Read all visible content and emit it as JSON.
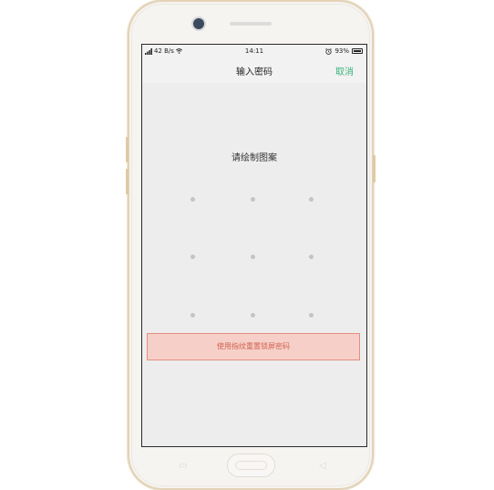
{
  "status_bar": {
    "network_speed": "42 B/s",
    "time": "14:11",
    "battery_percent": "93%",
    "signal_icon": "signal-icon",
    "wifi_icon": "wifi-icon",
    "alarm_icon": "alarm-icon"
  },
  "header": {
    "title": "输入密码",
    "cancel_label": "取消"
  },
  "pattern_lock": {
    "prompt": "请绘制图案",
    "dot_count": 9
  },
  "fingerprint_reset": {
    "label": "使用指纹重置锁屏密码"
  },
  "colors": {
    "accent": "#3ab37a",
    "warning_text": "#d2604f",
    "warning_bg": "#f6d0c8",
    "warning_border": "#e38e80",
    "screen_bg": "#ededed"
  }
}
